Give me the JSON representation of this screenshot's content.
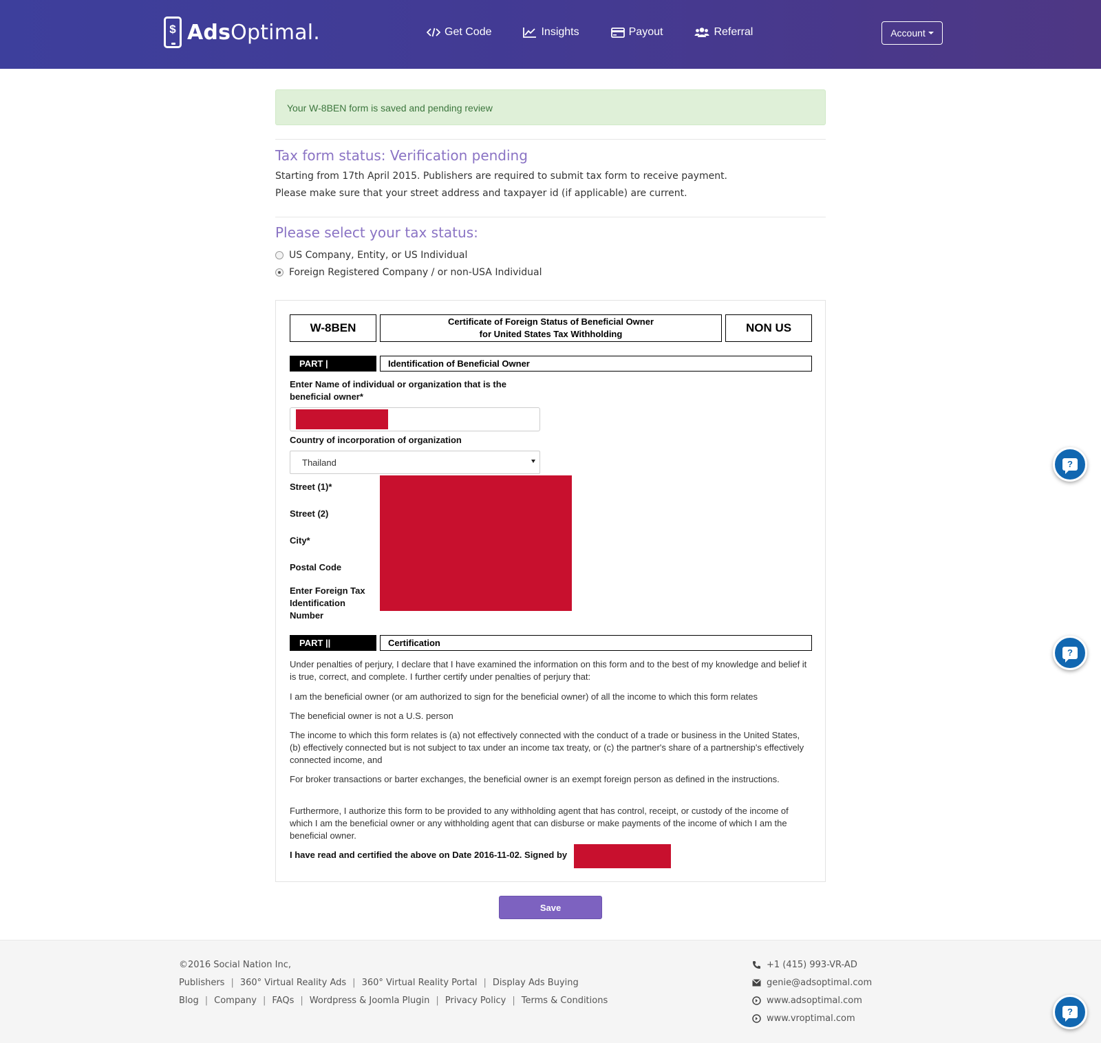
{
  "header": {
    "brand_bold": "Ads",
    "brand_rest": "Optimal.",
    "logo_symbol": "$",
    "nav": [
      {
        "label": "Get Code",
        "icon": "code-icon"
      },
      {
        "label": "Insights",
        "icon": "chart-line-icon"
      },
      {
        "label": "Payout",
        "icon": "credit-card-icon"
      },
      {
        "label": "Referral",
        "icon": "users-icon"
      }
    ],
    "account_label": "Account"
  },
  "alert": {
    "text": "Your W-8BEN form is saved and pending review"
  },
  "status": {
    "title": "Tax form status: Verification pending",
    "line1": "Starting from 17th April 2015. Publishers are required to submit tax form to receive payment.",
    "line2": "Please make sure that your street address and taxpayer id (if applicable) are current."
  },
  "tax_status": {
    "title": "Please select your tax status:",
    "options": [
      {
        "label": "US Company, Entity, or US Individual",
        "checked": false
      },
      {
        "label": "Foreign Registered Company / or non-USA Individual",
        "checked": true
      }
    ]
  },
  "form": {
    "code": "W-8BEN",
    "title_line1": "Certificate of Foreign Status of Beneficial Owner",
    "title_line2": "for United States Tax Withholding",
    "scope": "NON US",
    "part1": {
      "label": "PART |",
      "title": "Identification of Beneficial Owner",
      "name_label": "Enter Name of individual or organization that is the beneficial owner*",
      "country_label": "Country of incorporation of organization",
      "country_value": "Thailand",
      "street1_label": "Street (1)*",
      "street2_label": "Street (2)",
      "city_label": "City*",
      "postal_label": "Postal Code",
      "tin_label": "Enter Foreign Tax Identification Number"
    },
    "part2": {
      "label": "PART ||",
      "title": "Certification",
      "intro": "Under penalties of perjury, I declare that I have examined the information on this form and to the best of my knowledge and belief it is true, correct, and complete. I further certify under penalties of perjury that:",
      "item1": "I am the beneficial owner (or am authorized to sign for the beneficial owner) of all the income to which this form relates",
      "item2": "The beneficial owner is not a U.S. person",
      "item3": "The income to which this form relates is (a) not effectively connected with the conduct of a trade or business in the United States, (b) effectively connected but is not subject to tax under an income tax treaty, or (c) the partner's share of a partnership's effectively connected income, and",
      "item4": "For broker transactions or barter exchanges, the beneficial owner is an exempt foreign person as defined in the instructions.",
      "item5": "Furthermore, I authorize this form to be provided to any withholding agent that has control, receipt, or custody of the income of which I am the beneficial owner or any withholding agent that can disburse or make payments of the income of which I am the beneficial owner.",
      "signed": "I have read and certified the above on Date 2016-11-02. Signed by"
    }
  },
  "save_label": "Save",
  "footer": {
    "copyright": "©2016 Social Nation Inc,",
    "links_row1": [
      "Publishers",
      "360° Virtual Reality Ads",
      "360° Virtual Reality Portal",
      "Display Ads Buying"
    ],
    "links_row2": [
      "Blog",
      "Company",
      "FAQs",
      "Wordpress & Joomla Plugin",
      "Privacy Policy",
      "Terms & Conditions"
    ],
    "separator": "|",
    "phone": "+1 (415) 993-VR-AD",
    "email": "genie@adsoptimal.com",
    "site1": "www.adsoptimal.com",
    "site2": "www.vroptimal.com"
  },
  "help_symbol": "?",
  "colors": {
    "accent": "#8a73c4",
    "button": "#7d62c0",
    "redaction": "#c8102e",
    "help": "#1167b1",
    "alert_bg": "#dff0d8"
  }
}
